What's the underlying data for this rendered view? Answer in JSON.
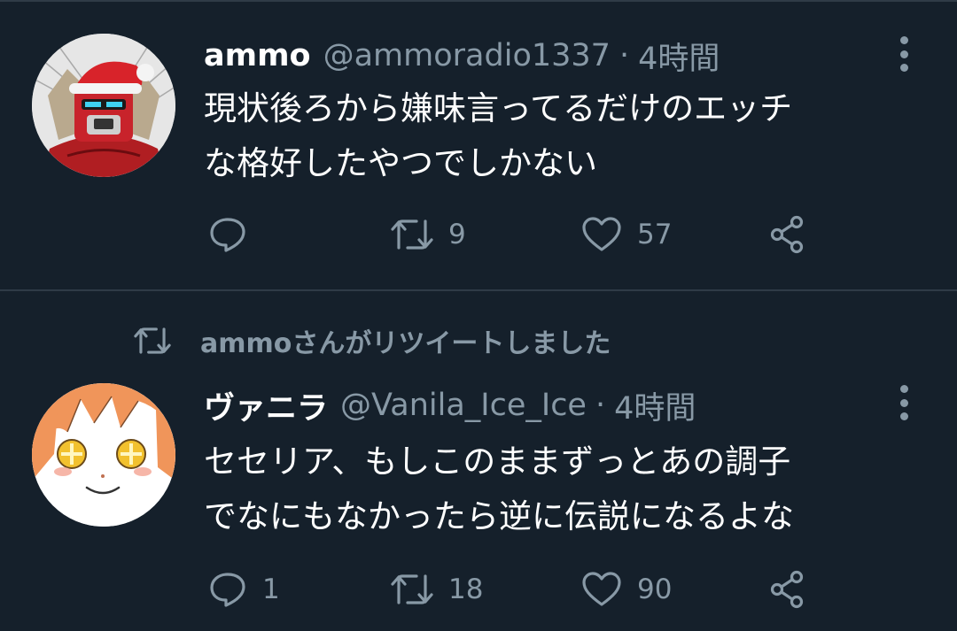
{
  "timeline": {
    "tweets": [
      {
        "display_name": "ammo",
        "handle": "@ammoradio1337",
        "separator": "·",
        "time": "4時間",
        "text_lines": [
          "現状後ろから嫌味言ってるだけのエッチ",
          "な格好したやつでしかない"
        ],
        "reply_count": "",
        "retweet_count": "9",
        "like_count": "57",
        "avatar_icon": "santa-robot-avatar"
      },
      {
        "retweeted_by_label": "ammoさんがリツイートしました",
        "display_name": "ヴァニラ",
        "handle": "@Vanila_Ice_Ice",
        "separator": "·",
        "time": "4時間",
        "text_lines": [
          "セセリア、もしこのままずっとあの調子",
          "でなにもなかったら逆に伝説になるよな"
        ],
        "reply_count": "1",
        "retweet_count": "18",
        "like_count": "90",
        "avatar_icon": "anime-girl-avatar"
      }
    ]
  },
  "colors": {
    "background": "#15202b",
    "divider": "#2f3b47",
    "secondary_text": "#8899a6",
    "primary_text": "#ffffff"
  }
}
